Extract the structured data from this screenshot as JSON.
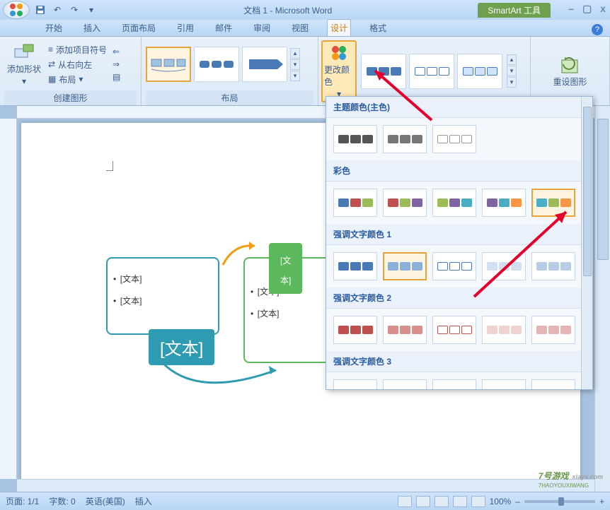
{
  "title": "文档 1 - Microsoft Word",
  "smartart_tools": "SmartArt 工具",
  "window_buttons": {
    "min": "–",
    "max": "▢",
    "close": "x"
  },
  "qat": {
    "save": "save-icon",
    "undo": "undo-icon",
    "redo": "redo-icon",
    "more": "▾"
  },
  "tabs": [
    "开始",
    "插入",
    "页面布局",
    "引用",
    "邮件",
    "审阅",
    "视图",
    "设计",
    "格式"
  ],
  "active_tab": "设计",
  "ribbon": {
    "create_group": {
      "label": "创建图形",
      "add_shape": "添加形状",
      "bullets": "添加项目符号",
      "rtl": "从右向左",
      "layout": "布局"
    },
    "layout_group": {
      "label": "布局"
    },
    "change_color": "更改颜色",
    "reset": "重设图形"
  },
  "doc": {
    "text_placeholder": "[文本]",
    "bullet": "•"
  },
  "color_dropdown": {
    "sections": [
      "主题颜色(主色)",
      "彩色",
      "强调文字颜色 1",
      "强调文字颜色 2",
      "强调文字颜色 3"
    ],
    "more": "...."
  },
  "statusbar": {
    "page": "页面: 1/1",
    "words": "字数: 0",
    "lang": "英语(美国)",
    "insert": "插入",
    "zoom": "100%",
    "minus": "–",
    "plus": "+"
  },
  "watermark": {
    "main": "7号游戏",
    "sub": "7HAOYOUXIWANG",
    "url": "xiayx.com"
  }
}
